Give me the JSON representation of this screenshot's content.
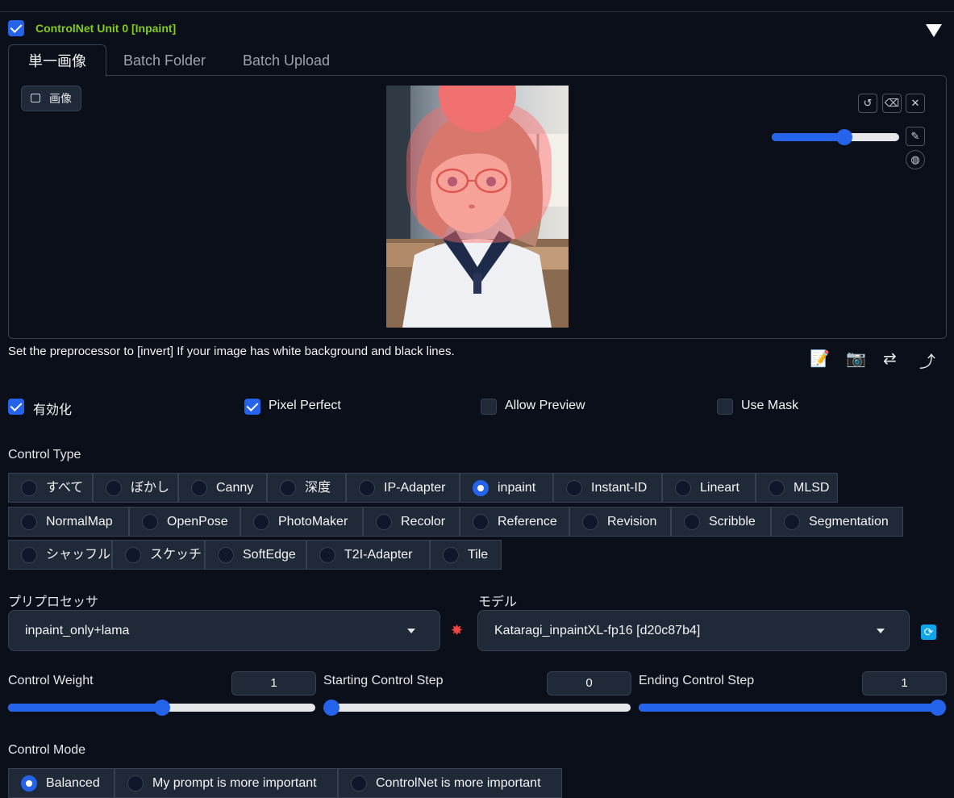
{
  "unit": {
    "title": "ControlNet Unit 0  [Inpaint]",
    "enabled": true
  },
  "tabs": [
    {
      "label": "単一画像",
      "active": true
    },
    {
      "label": "Batch Folder",
      "active": false
    },
    {
      "label": "Batch Upload",
      "active": false
    }
  ],
  "image_panel": {
    "label": "画像",
    "brush_size_fraction": 0.58
  },
  "hint": "Set the preprocessor to [invert] If your image has white background and black lines.",
  "checkboxes": [
    {
      "label": "有効化",
      "checked": true
    },
    {
      "label": "Pixel Perfect",
      "checked": true
    },
    {
      "label": "Allow Preview",
      "checked": false
    },
    {
      "label": "Use Mask",
      "checked": false
    }
  ],
  "control_type": {
    "label": "Control Type",
    "selected": "inpaint",
    "options": [
      "すべて",
      "ぼかし",
      "Canny",
      "深度",
      "IP-Adapter",
      "inpaint",
      "Instant-ID",
      "Lineart",
      "MLSD",
      "NormalMap",
      "OpenPose",
      "PhotoMaker",
      "Recolor",
      "Reference",
      "Revision",
      "Scribble",
      "Segmentation",
      "シャッフル",
      "スケッチ",
      "SoftEdge",
      "T2I-Adapter",
      "Tile"
    ]
  },
  "preprocessor": {
    "label": "プリプロセッサ",
    "value": "inpaint_only+lama"
  },
  "model": {
    "label": "モデル",
    "value": "Kataragi_inpaintXL-fp16 [d20c87b4]"
  },
  "control_weight": {
    "label": "Control Weight",
    "value": "1",
    "fraction": 0.5
  },
  "starting_step": {
    "label": "Starting Control Step",
    "value": "0",
    "fraction": 0.0
  },
  "ending_step": {
    "label": "Ending Control Step",
    "value": "1",
    "fraction": 1.0
  },
  "control_mode": {
    "label": "Control Mode",
    "selected": "Balanced",
    "options": [
      "Balanced",
      "My prompt is more important",
      "ControlNet is more important"
    ]
  },
  "colors": {
    "accent": "#2563eb",
    "title_green": "#84cc16",
    "background": "#0b0f19"
  }
}
